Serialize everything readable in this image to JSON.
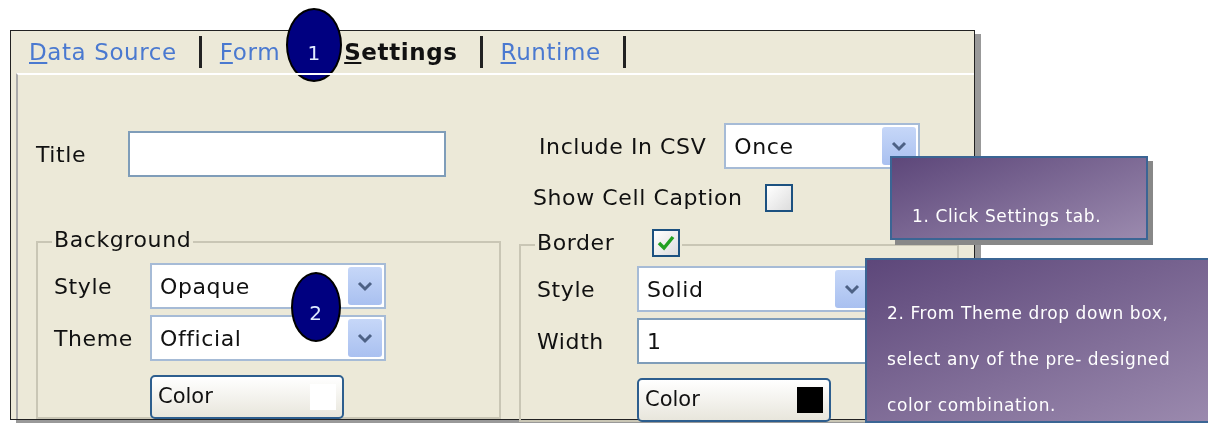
{
  "tabs": [
    {
      "label": "Data Source",
      "selected": false
    },
    {
      "label": "Form",
      "selected": false
    },
    {
      "label": "Settings",
      "selected": true
    },
    {
      "label": "Runtime",
      "selected": false
    }
  ],
  "title_field": {
    "label": "Title"
  },
  "include_in_csv": {
    "label": "Include In CSV",
    "value": "Once"
  },
  "show_cell_caption": {
    "label": "Show Cell Caption",
    "checked": false
  },
  "background": {
    "legend": "Background",
    "style": {
      "label": "Style",
      "value": "Opaque"
    },
    "theme": {
      "label": "Theme",
      "value": "Official"
    },
    "color_button": {
      "label": "Color",
      "color": "#ffffff"
    }
  },
  "border": {
    "legend": "Border",
    "checked": true,
    "style": {
      "label": "Style",
      "value": "Solid"
    },
    "width": {
      "label": "Width",
      "value": "1"
    },
    "color_button": {
      "label": "Color",
      "color": "#000000"
    }
  },
  "step_markers": [
    {
      "number": "1"
    },
    {
      "number": "2"
    }
  ],
  "callouts": [
    {
      "text": "1. Click Settings tab."
    },
    {
      "text": "2. From Theme drop down box, select any of the pre- designed color combination."
    }
  ]
}
